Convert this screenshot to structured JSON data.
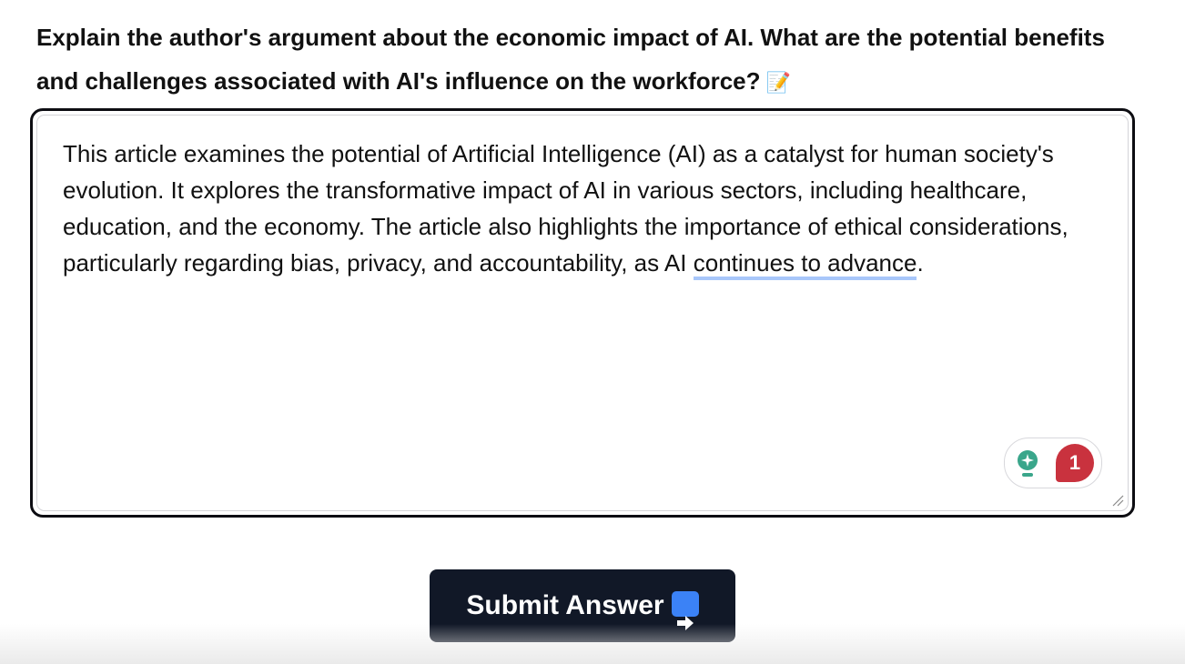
{
  "question": {
    "text": "Explain the author's argument about the economic impact of AI. What are the potential benefits and challenges associated with AI's influence on the workforce?",
    "emoji": "📝"
  },
  "answer": {
    "text_main": "This article examines the potential of Artificial Intelligence (AI) as a catalyst for human society's evolution. It explores the transformative impact of AI in various sectors, including healthcare, education, and the economy. The article also highlights the importance of ethical considerations, particularly regarding bias, privacy, and accountability, as AI ",
    "text_underlined": "continues to advance",
    "text_end": "."
  },
  "assistant_widget": {
    "icon": "lightbulb-icon",
    "suggestion_count": "1",
    "badge_color": "#c9323e",
    "icon_color": "#3aa68b"
  },
  "submit": {
    "label": "Submit Answer",
    "icon": "right-arrow-icon",
    "bg_color": "#111827"
  }
}
